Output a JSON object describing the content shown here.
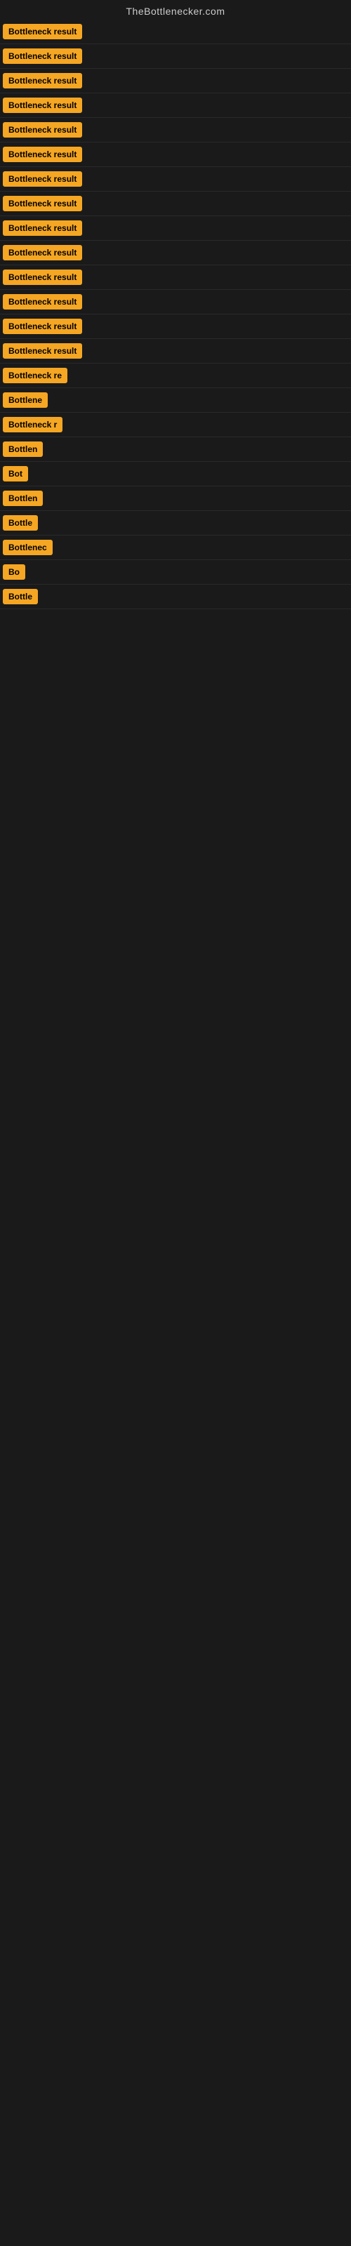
{
  "site": {
    "title": "TheBottlenecker.com"
  },
  "colors": {
    "badge_bg": "#f5a623",
    "badge_text": "#000000",
    "page_bg": "#1a1a1a"
  },
  "rows": [
    {
      "id": 1,
      "label": "Bottleneck result",
      "width": "100%"
    },
    {
      "id": 2,
      "label": "Bottleneck result",
      "width": "100%"
    },
    {
      "id": 3,
      "label": "Bottleneck result",
      "width": "100%"
    },
    {
      "id": 4,
      "label": "Bottleneck result",
      "width": "100%"
    },
    {
      "id": 5,
      "label": "Bottleneck result",
      "width": "100%"
    },
    {
      "id": 6,
      "label": "Bottleneck result",
      "width": "100%"
    },
    {
      "id": 7,
      "label": "Bottleneck result",
      "width": "100%"
    },
    {
      "id": 8,
      "label": "Bottleneck result",
      "width": "100%"
    },
    {
      "id": 9,
      "label": "Bottleneck result",
      "width": "100%"
    },
    {
      "id": 10,
      "label": "Bottleneck result",
      "width": "100%"
    },
    {
      "id": 11,
      "label": "Bottleneck result",
      "width": "100%"
    },
    {
      "id": 12,
      "label": "Bottleneck result",
      "width": "100%"
    },
    {
      "id": 13,
      "label": "Bottleneck result",
      "width": "100%"
    },
    {
      "id": 14,
      "label": "Bottleneck result",
      "width": "100%"
    },
    {
      "id": 15,
      "label": "Bottleneck re",
      "width": "75%"
    },
    {
      "id": 16,
      "label": "Bottlene",
      "width": "55%"
    },
    {
      "id": 17,
      "label": "Bottleneck r",
      "width": "65%"
    },
    {
      "id": 18,
      "label": "Bottlen",
      "width": "50%"
    },
    {
      "id": 19,
      "label": "Bot",
      "width": "30%"
    },
    {
      "id": 20,
      "label": "Bottlen",
      "width": "50%"
    },
    {
      "id": 21,
      "label": "Bottle",
      "width": "42%"
    },
    {
      "id": 22,
      "label": "Bottlenec",
      "width": "60%"
    },
    {
      "id": 23,
      "label": "Bo",
      "width": "22%"
    },
    {
      "id": 24,
      "label": "Bottle",
      "width": "42%"
    }
  ]
}
